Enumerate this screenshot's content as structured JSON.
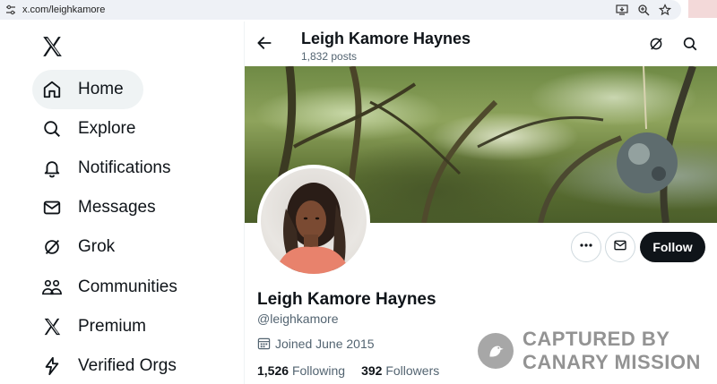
{
  "browser": {
    "url": "x.com/leighkamore",
    "icons": [
      "tune-icon",
      "install-icon",
      "zoom-icon",
      "star-icon"
    ]
  },
  "sidebar": {
    "logo": "x-logo-icon",
    "items": [
      {
        "label": "Home",
        "icon": "home-icon",
        "active": true
      },
      {
        "label": "Explore",
        "icon": "search-icon"
      },
      {
        "label": "Notifications",
        "icon": "bell-icon"
      },
      {
        "label": "Messages",
        "icon": "envelope-icon"
      },
      {
        "label": "Grok",
        "icon": "grok-icon"
      },
      {
        "label": "Communities",
        "icon": "communities-icon"
      },
      {
        "label": "Premium",
        "icon": "x-logo-icon"
      },
      {
        "label": "Verified Orgs",
        "icon": "lightning-icon"
      }
    ]
  },
  "header": {
    "name": "Leigh Kamore Haynes",
    "posts": "1,832 posts"
  },
  "profile": {
    "name": "Leigh Kamore Haynes",
    "handle": "@leighkamore",
    "joined": "Joined June 2015",
    "following_count": "1,526",
    "following_label": "Following",
    "followers_count": "392",
    "followers_label": "Followers",
    "follow_button": "Follow"
  },
  "watermark": {
    "line1": "CAPTURED BY",
    "line2": "CANARY MISSION"
  },
  "colors": {
    "text": "#0f1419",
    "muted": "#536471",
    "active_bg": "#eff3f4",
    "follow_bg": "#0f1419"
  }
}
